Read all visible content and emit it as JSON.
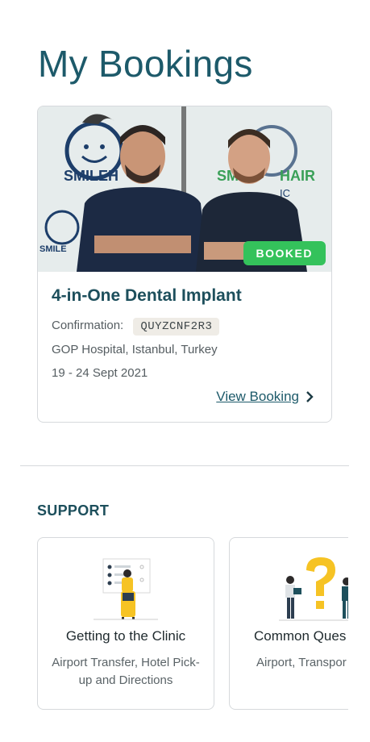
{
  "page": {
    "title": "My Bookings"
  },
  "booking": {
    "photo_alt": "SMILE HAIR CLINIC",
    "status": "BOOKED",
    "title": "4-in-One Dental Implant",
    "confirmation_label": "Confirmation:",
    "confirmation_code": "QUYZCNF2R3",
    "location": "GOP Hospital, Istanbul, Turkey",
    "dates": "19 - 24 Sept 2021",
    "view_label": "View Booking",
    "colors": {
      "badge": "#34c25b",
      "title": "#1d4f5c"
    }
  },
  "support": {
    "heading": "SUPPORT",
    "cards": [
      {
        "title": "Getting to the Clinic",
        "desc": "Airport Transfer, Hotel Pick-up and Directions",
        "icon": "checklist-person-illustration"
      },
      {
        "title": "Common Ques",
        "desc": "Airport, Transpor Directions",
        "icon": "question-mark-people-illustration"
      }
    ]
  }
}
